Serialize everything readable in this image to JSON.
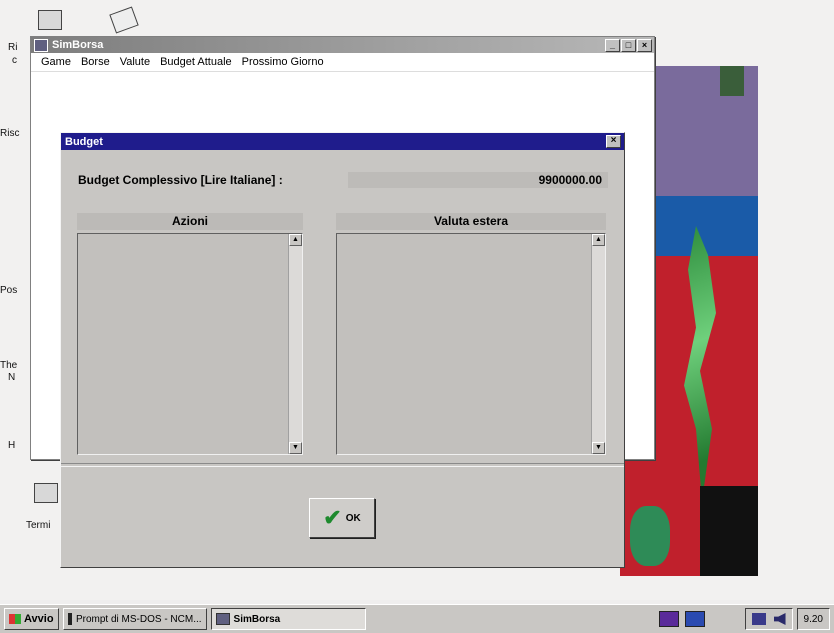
{
  "desktop": {
    "icon_labels": [
      "Ri",
      "c",
      "Risc",
      "Pos",
      "The",
      "N",
      "H",
      "Termi"
    ]
  },
  "main_window": {
    "title": "SimBorsa",
    "menu": [
      "Game",
      "Borse",
      "Valute",
      "Budget Attuale",
      "Prossimo Giorno"
    ]
  },
  "dialog": {
    "title": "Budget",
    "budget_label": "Budget Complessivo [Lire Italiane] :",
    "budget_value": "9900000.00",
    "panels": [
      {
        "header": "Azioni"
      },
      {
        "header": "Valuta estera"
      }
    ],
    "ok_label": "OK"
  },
  "taskbar": {
    "start_label": "Avvio",
    "tasks": [
      "Prompt di MS-DOS - NCM...",
      "SimBorsa"
    ],
    "clock": "9.20"
  }
}
